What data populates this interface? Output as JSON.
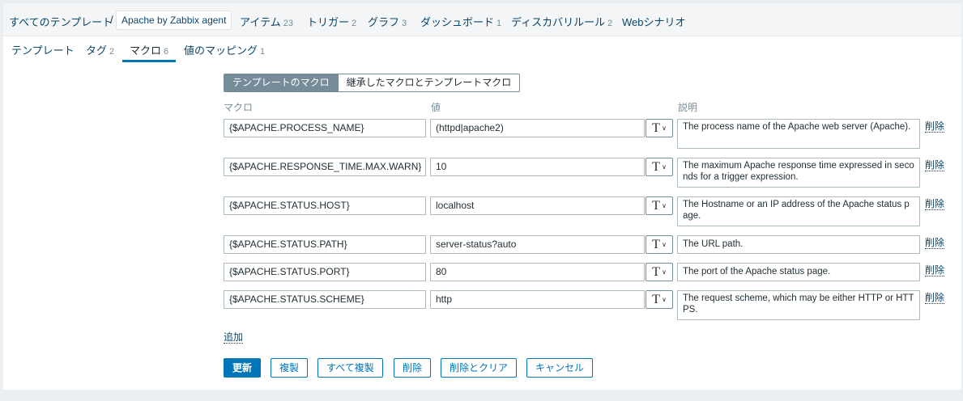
{
  "header": {
    "crumb_all": "すべてのテンプレート",
    "crumb_sep": "/",
    "crumb_current": "Apache by Zabbix agent",
    "links": [
      {
        "label": "アイテム",
        "count": "23"
      },
      {
        "label": "トリガー",
        "count": "2"
      },
      {
        "label": "グラフ",
        "count": "3"
      },
      {
        "label": "ダッシュボード",
        "count": "1"
      },
      {
        "label": "ディスカバリルール",
        "count": "2"
      },
      {
        "label": "Webシナリオ",
        "count": ""
      }
    ]
  },
  "tabs": [
    {
      "label": "テンプレート",
      "count": ""
    },
    {
      "label": "タグ",
      "count": "2"
    },
    {
      "label": "マクロ",
      "count": "6"
    },
    {
      "label": "値のマッピング",
      "count": "1"
    }
  ],
  "toggle": {
    "template_macros": "テンプレートのマクロ",
    "inherited_macros": "継承したマクロとテンプレートマクロ"
  },
  "columns": {
    "macro": "マクロ",
    "value": "値",
    "description": "説明"
  },
  "macros": [
    {
      "macro": "{$APACHE.PROCESS_NAME}",
      "value": "(httpd|apache2)",
      "description": "The process name of the Apache web server (Apache).",
      "remove": "削除"
    },
    {
      "macro": "{$APACHE.RESPONSE_TIME.MAX.WARN}",
      "value": "10",
      "description": "The maximum Apache response time expressed in seconds for a trigger expression.",
      "remove": "削除"
    },
    {
      "macro": "{$APACHE.STATUS.HOST}",
      "value": "localhost",
      "description": "The Hostname or an IP address of the Apache status page.",
      "remove": "削除"
    },
    {
      "macro": "{$APACHE.STATUS.PATH}",
      "value": "server-status?auto",
      "description": "The URL path.",
      "remove": "削除"
    },
    {
      "macro": "{$APACHE.STATUS.PORT}",
      "value": "80",
      "description": "The port of the Apache status page.",
      "remove": "削除"
    },
    {
      "macro": "{$APACHE.STATUS.SCHEME}",
      "value": "http",
      "description": "The request scheme, which may be either HTTP or HTTPS.",
      "remove": "削除"
    }
  ],
  "type_button": {
    "glyph": "T",
    "icon": "text-type-icon",
    "chevron": "chevron-down-icon"
  },
  "add_link": "追加",
  "buttons": {
    "update": "更新",
    "clone": "複製",
    "full_clone": "すべて複製",
    "delete": "削除",
    "delete_clear": "削除とクリア",
    "cancel": "キャンセル"
  },
  "colors": {
    "accent": "#0275b8",
    "link": "#0a466a",
    "toggle_active": "#768d99"
  }
}
